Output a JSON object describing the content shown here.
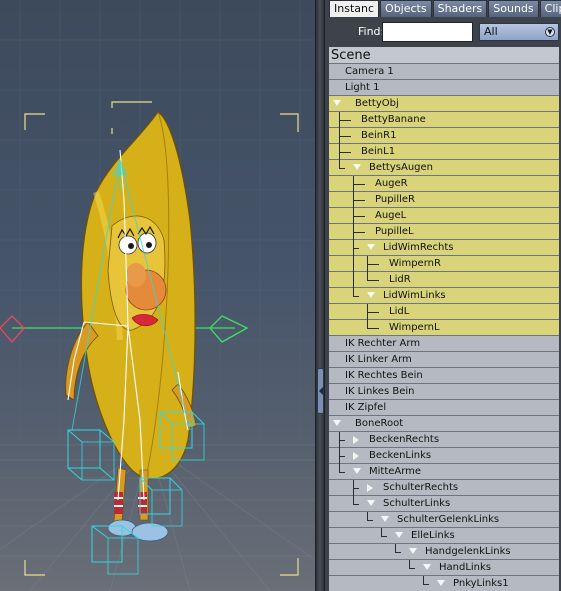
{
  "tabs": [
    {
      "label": "Instanc",
      "active": true
    },
    {
      "label": "Objects",
      "active": false
    },
    {
      "label": "Shaders",
      "active": false
    },
    {
      "label": "Sounds",
      "active": false
    },
    {
      "label": "Clips",
      "active": false
    }
  ],
  "find": {
    "label": "Find:",
    "value": "",
    "filter": "All"
  },
  "scene_header": "Scene",
  "tree": [
    {
      "label": "Camera 1",
      "depth": 0,
      "toggle": "none",
      "selected": false
    },
    {
      "label": "Light 1",
      "depth": 0,
      "toggle": "none",
      "selected": false
    },
    {
      "label": "BettyObj",
      "depth": 0,
      "toggle": "open",
      "selected": true
    },
    {
      "label": "BettyBanane",
      "depth": 1,
      "toggle": "none",
      "selected": true
    },
    {
      "label": "BeinR1",
      "depth": 1,
      "toggle": "none",
      "selected": true
    },
    {
      "label": "BeinL1",
      "depth": 1,
      "toggle": "none",
      "selected": true
    },
    {
      "label": "BettysAugen",
      "depth": 1,
      "toggle": "open",
      "selected": true
    },
    {
      "label": "AugeR",
      "depth": 2,
      "toggle": "none",
      "selected": true
    },
    {
      "label": "PupilleR",
      "depth": 2,
      "toggle": "none",
      "selected": true
    },
    {
      "label": "AugeL",
      "depth": 2,
      "toggle": "none",
      "selected": true
    },
    {
      "label": "PupilleL",
      "depth": 2,
      "toggle": "none",
      "selected": true
    },
    {
      "label": "LidWimRechts",
      "depth": 2,
      "toggle": "open",
      "selected": true
    },
    {
      "label": "WimpernR",
      "depth": 3,
      "toggle": "none",
      "selected": true
    },
    {
      "label": "LidR",
      "depth": 3,
      "toggle": "none",
      "selected": true
    },
    {
      "label": "LidWimLinks",
      "depth": 2,
      "toggle": "open",
      "selected": true
    },
    {
      "label": "LidL",
      "depth": 3,
      "toggle": "none",
      "selected": true
    },
    {
      "label": "WimpernL",
      "depth": 3,
      "toggle": "none",
      "selected": true
    },
    {
      "label": "IK Rechter Arm",
      "depth": 0,
      "toggle": "none",
      "selected": false
    },
    {
      "label": "IK Linker Arm",
      "depth": 0,
      "toggle": "none",
      "selected": false
    },
    {
      "label": "IK Rechtes Bein",
      "depth": 0,
      "toggle": "none",
      "selected": false
    },
    {
      "label": "IK Linkes Bein",
      "depth": 0,
      "toggle": "none",
      "selected": false
    },
    {
      "label": "IK Zipfel",
      "depth": 0,
      "toggle": "none",
      "selected": false
    },
    {
      "label": "BoneRoot",
      "depth": 0,
      "toggle": "open",
      "selected": false
    },
    {
      "label": "BeckenRechts",
      "depth": 1,
      "toggle": "closed",
      "selected": false
    },
    {
      "label": "BeckenLinks",
      "depth": 1,
      "toggle": "closed",
      "selected": false
    },
    {
      "label": "MitteArme",
      "depth": 1,
      "toggle": "open",
      "selected": false
    },
    {
      "label": "SchulterRechts",
      "depth": 2,
      "toggle": "closed",
      "selected": false
    },
    {
      "label": "SchulterLinks",
      "depth": 2,
      "toggle": "open",
      "selected": false
    },
    {
      "label": "SchulterGelenkLinks",
      "depth": 3,
      "toggle": "open",
      "selected": false
    },
    {
      "label": "ElleLinks",
      "depth": 4,
      "toggle": "open",
      "selected": false
    },
    {
      "label": "HandgelenkLinks",
      "depth": 5,
      "toggle": "open",
      "selected": false
    },
    {
      "label": "HandLinks",
      "depth": 6,
      "toggle": "open",
      "selected": false
    },
    {
      "label": "PnkyLinks1",
      "depth": 7,
      "toggle": "open",
      "selected": false
    }
  ],
  "colors": {
    "selected_row": "#d9d47a",
    "normal_row": "#b5bac2",
    "tab_active": "#f0f0f0",
    "tab_inactive": "#6a7892",
    "ik_handle": "#e84a55",
    "gizmo_green": "#3ee060",
    "bounding_box": "#31d8e0"
  },
  "icons": {
    "splitter": "collapse-arrow-icon",
    "dropdown": "chevron-down-icon",
    "tree_open": "triangle-down-icon",
    "tree_closed": "triangle-right-icon"
  }
}
